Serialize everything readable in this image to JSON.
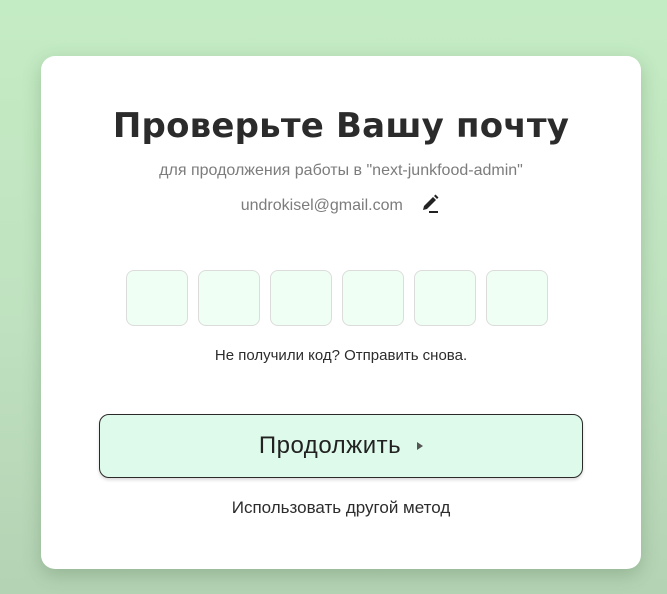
{
  "card": {
    "title": "Проверьте Вашу почту",
    "subtitle": "для продолжения работы в \"next-junkfood-admin\"",
    "email": "undrokisel@gmail.com",
    "edit_icon": "pencil-icon",
    "otp": {
      "digits": [
        "",
        "",
        "",
        "",
        "",
        ""
      ]
    },
    "resend_prompt": "Не получили код?",
    "resend_link": "Отправить снова.",
    "continue_label": "Продолжить",
    "continue_icon": "triangle-right-icon",
    "other_method": "Использовать другой метод"
  },
  "colors": {
    "background": "#c4ecc4",
    "card": "#ffffff",
    "otp_fill": "#f0fff3",
    "button_fill": "#defaea",
    "muted_text": "#7c7c7c"
  }
}
